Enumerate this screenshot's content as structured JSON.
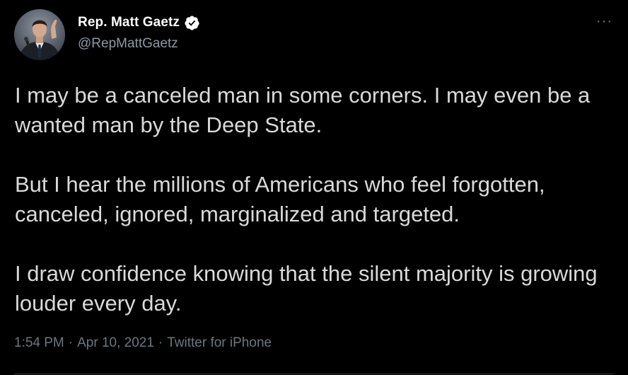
{
  "author": {
    "display_name": "Rep. Matt Gaetz",
    "handle": "@RepMattGaetz",
    "verified": true,
    "avatar_icon": "profile-photo"
  },
  "more_menu": {
    "label": "···"
  },
  "tweet": {
    "paragraphs": [
      "I may be a canceled man in some corners. I may even be a wanted man by the Deep State.",
      "But I hear the millions of Americans who feel forgotten, canceled, ignored, marginalized and targeted.",
      "I draw confidence knowing that the silent majority is growing louder every day."
    ]
  },
  "meta": {
    "time": "1:54 PM",
    "date": "Apr 10, 2021",
    "source": "Twitter for iPhone",
    "separator": "·"
  },
  "colors": {
    "background": "#000000",
    "name": "#ffffff",
    "body_text": "#d9d9d9",
    "secondary_text": "#8b98a5",
    "muted_text": "#6e767d",
    "divider": "#2f3336"
  }
}
